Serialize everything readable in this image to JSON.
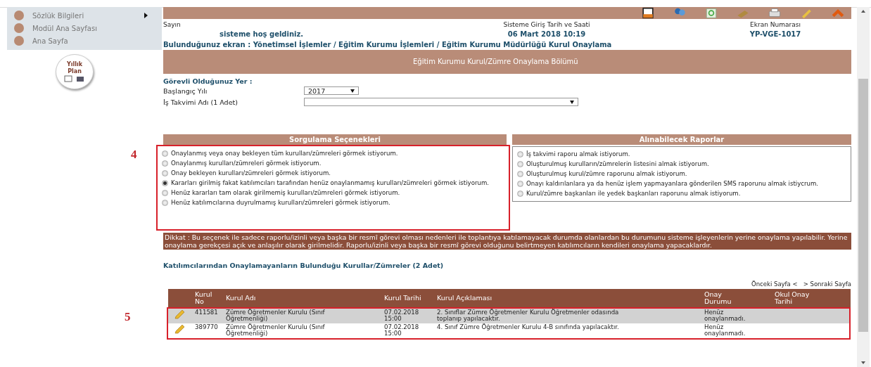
{
  "sidebar": {
    "items": [
      {
        "label": "Sözlük Bilgileri",
        "has_submenu": true
      },
      {
        "label": "Modül Ana Sayfası",
        "has_submenu": false
      },
      {
        "label": "Ana Sayfa",
        "has_submenu": false
      }
    ],
    "plan_button": {
      "line1": "Yıllık",
      "line2": "Plan"
    }
  },
  "header": {
    "greeting_label": "Sayın",
    "greeting": "sisteme hoş geldiniz.",
    "login_label": "Sisteme Giriş Tarih ve Saati",
    "login_time": "06 Mart 2018 10:19",
    "screen_label": "Ekran Numarası",
    "screen_number": "YP-VGE-1017"
  },
  "breadcrumb": "Bulunduğunuz ekran : Yönetimsel İşlemler / Eğitim Kurumu İşlemleri / Eğitim Kurumu Müdürlüğü Kurul Onaylama",
  "section_title": "Eğitim Kurumu Kurul/Zümre Onaylama Bölümü",
  "location_title": "Görevli Olduğunuz Yer :",
  "fields": [
    {
      "label": "Başlangıç Yılı",
      "value": "2017",
      "kind": "short"
    },
    {
      "label": "İş Takvimi Adı (1 Adet)",
      "kind": "long"
    }
  ],
  "query_panel": {
    "title": "Sorgulama Seçenekleri",
    "callout": "4",
    "options": [
      {
        "label": "Onaylanmış veya onay bekleyen tüm kurulları/zümreleri görmek istiyorum.",
        "selected": false
      },
      {
        "label": "Onaylanmış kurulları/zümreleri görmek istiyorum.",
        "selected": false
      },
      {
        "label": "Onay bekleyen kurulları/zümreleri görmek istiyorum.",
        "selected": false
      },
      {
        "label": "Kararları girilmiş fakat katılımcıları tarafından henüz onaylanmamış kurulları/zümreleri görmek istiyorum.",
        "selected": true
      },
      {
        "label": "Henüz kararları tam olarak girilmemiş kurulları/zümreleri görmek istiyorum.",
        "selected": false
      },
      {
        "label": "Henüz katılımcılarına duyrulmamış kurulları/zümreleri görmek istiyorum.",
        "selected": false
      }
    ]
  },
  "report_panel": {
    "title": "Alınabilecek Raporlar",
    "options": [
      {
        "label": "İş takvimi raporu almak istiyorum.",
        "selected": false
      },
      {
        "label": "Oluşturulmuş kurulların/zümrelerin listesini almak istiyorum.",
        "selected": false
      },
      {
        "label": "Oluşturulmuş kurul/zümre raporunu almak istiyorum.",
        "selected": false
      },
      {
        "label": "Onayı kaldırılanlara ya da henüz işlem yapmayanlara gönderilen SMS raporunu almak istiycrum.",
        "selected": false
      },
      {
        "label": "Kurul/zümre başkanları ile yedek başkanları raporunu almak istiyorum.",
        "selected": false
      }
    ]
  },
  "notice": "Dikkat : Bu seçenek ile sadece raporlu/izinli veya başka bir resmî görevi olması nedenleri ile toplantıya katılamayacak durumda olanlardan bu durumunu sisteme işleyenlerin yerine onaylama yapılabilir. Yerine onaylama gerekçesi açık ve anlaşılır olarak girilmelidir. Raporlu/izinli veya başka bir resmî görevi olduğunu belirtmeyen katılımcıların kendileri onaylama yapacaklardır.",
  "results_title": "Katılımcılarından Onaylamayanların Bulunduğu Kurullar/Zümreler (2 Adet)",
  "paging": {
    "previous": "Önceki Sayfa <",
    "next": "> Sonraki Sayfa"
  },
  "table": {
    "callout": "5",
    "columns": [
      "Kurul No",
      "Kurul Adı",
      "Kurul Tarihi",
      "Kurul Açıklaması",
      "Onay Durumu",
      "Okul Onay Tarihi"
    ],
    "rows": [
      {
        "selected": true,
        "cells": [
          "411581",
          "Zümre Öğretmenler Kurulu (Sınıf Öğretmenliği)",
          "07.02.2018 15:00",
          "2. Sınıflar Zümre Öğretmenler Kurulu Öğretmenler odasında toplanıp yapılacaktır.",
          "Henüz onaylanmadı."
        ]
      },
      {
        "selected": false,
        "cells": [
          "389770",
          "Zümre Öğretmenler Kurulu (Sınıf Öğretmenliği)",
          "07.02.2018 15:00",
          "4. Sınıf Zümre Öğretmenler Kurulu 4-B sınıfında yapılacaktır.",
          "Henüz onaylanmadı."
        ]
      }
    ]
  }
}
